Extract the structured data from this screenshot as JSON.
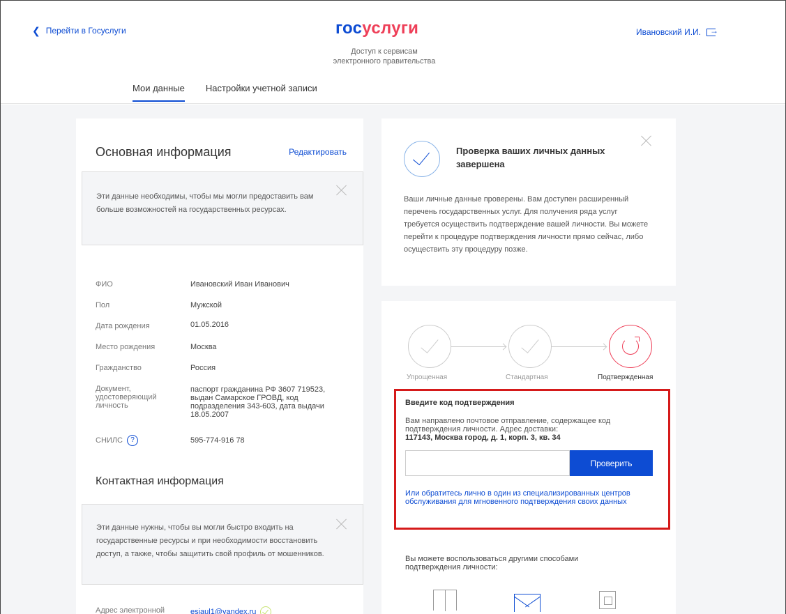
{
  "header": {
    "back_link": "Перейти в Госуслуги",
    "logo_part1": "гос",
    "logo_part2": "услуги",
    "subtitle_line1": "Доступ к сервисам",
    "subtitle_line2": "электронного правительства",
    "user_name": "Ивановский И.И."
  },
  "tabs": [
    {
      "label": "Мои данные",
      "active": true
    },
    {
      "label": "Настройки учетной записи",
      "active": false
    }
  ],
  "main_info": {
    "title": "Основная информация",
    "edit_label": "Редактировать",
    "notice": "Эти данные необходимы, чтобы мы могли предоставить вам больше возможностей на государственных ресурсах.",
    "rows": [
      {
        "label": "ФИО",
        "value": "Ивановский Иван Иванович"
      },
      {
        "label": "Пол",
        "value": "Мужской"
      },
      {
        "label": "Дата рождения",
        "value": "01.05.2016"
      },
      {
        "label": "Место рождения",
        "value": "Москва"
      },
      {
        "label": "Гражданство",
        "value": "Россия"
      },
      {
        "label": "Документ, удостоверяющий личность",
        "value": "паспорт гражданина РФ 3607 719523, выдан Самарское ГРОВД, код подразделения 343-603, дата выдачи 18.05.2007"
      },
      {
        "label": "СНИЛС",
        "value": "595-774-916 78"
      }
    ],
    "help_glyph": "?"
  },
  "contact_info": {
    "title": "Контактная информация",
    "notice": "Эти данные нужны, чтобы вы могли быстро входить на государственные ресурсы и при необходимости восстановить доступ, а также, чтобы защитить свой профиль от мошенников.",
    "email_label": "Адрес электронной почты",
    "email_value": "esiaul1@yandex.ru"
  },
  "verify_card": {
    "title": "Проверка ваших личных данных завершена",
    "text": "Ваши личные данные проверены. Вам доступен расширенный перечень государственных услуг. Для получения ряда услуг требуется осуществить подтверждение вашей личности. Вы можете перейти к процедуре подтверждения личности прямо сейчас, либо осуществить эту процедуру позже."
  },
  "levels": {
    "steps": [
      {
        "label": "Упрощенная"
      },
      {
        "label": "Стандартная"
      },
      {
        "label": "Подтвержденная"
      }
    ],
    "code_title": "Введите код подтверждения",
    "code_text": "Вам направлено почтовое отправление, содержащее код подтверждения личности. Адрес доставки:",
    "code_address": "117143, Москва город, д. 1, корп. 3, кв. 34",
    "code_input_value": "",
    "check_button": "Проверить",
    "office_link": "Или обратитесь лично в один из специализированных центров обслуживания для мгновенного подтверждения своих данных",
    "other_ways": "Вы можете воспользоваться другими способами подтверждения личности:"
  },
  "colors": {
    "brand_blue": "#0d4cd3",
    "brand_red": "#ee3f58",
    "highlight_red": "#d51a1a"
  }
}
